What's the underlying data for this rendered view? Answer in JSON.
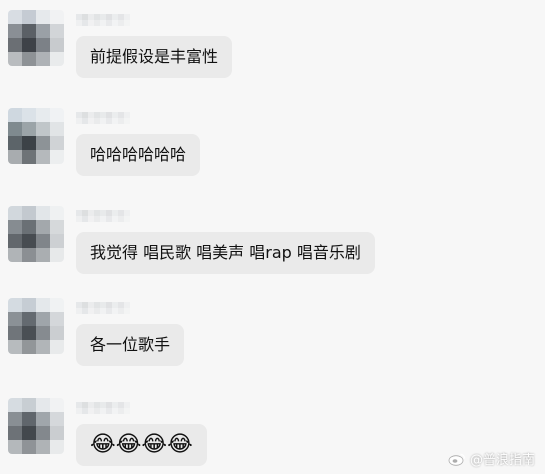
{
  "messages": [
    {
      "text": "前提假设是丰富性"
    },
    {
      "text": "哈哈哈哈哈哈"
    },
    {
      "text": "我觉得 唱民歌 唱美声 唱rap 唱音乐剧"
    },
    {
      "text": "各一位歌手"
    },
    {
      "text": "😂😂😂😂"
    }
  ],
  "watermark": {
    "icon": "weibo-icon",
    "text": "@普浪指南"
  },
  "colors": {
    "background": "#f7f7f7",
    "bubble": "#eaeaea",
    "text": "#111111"
  }
}
